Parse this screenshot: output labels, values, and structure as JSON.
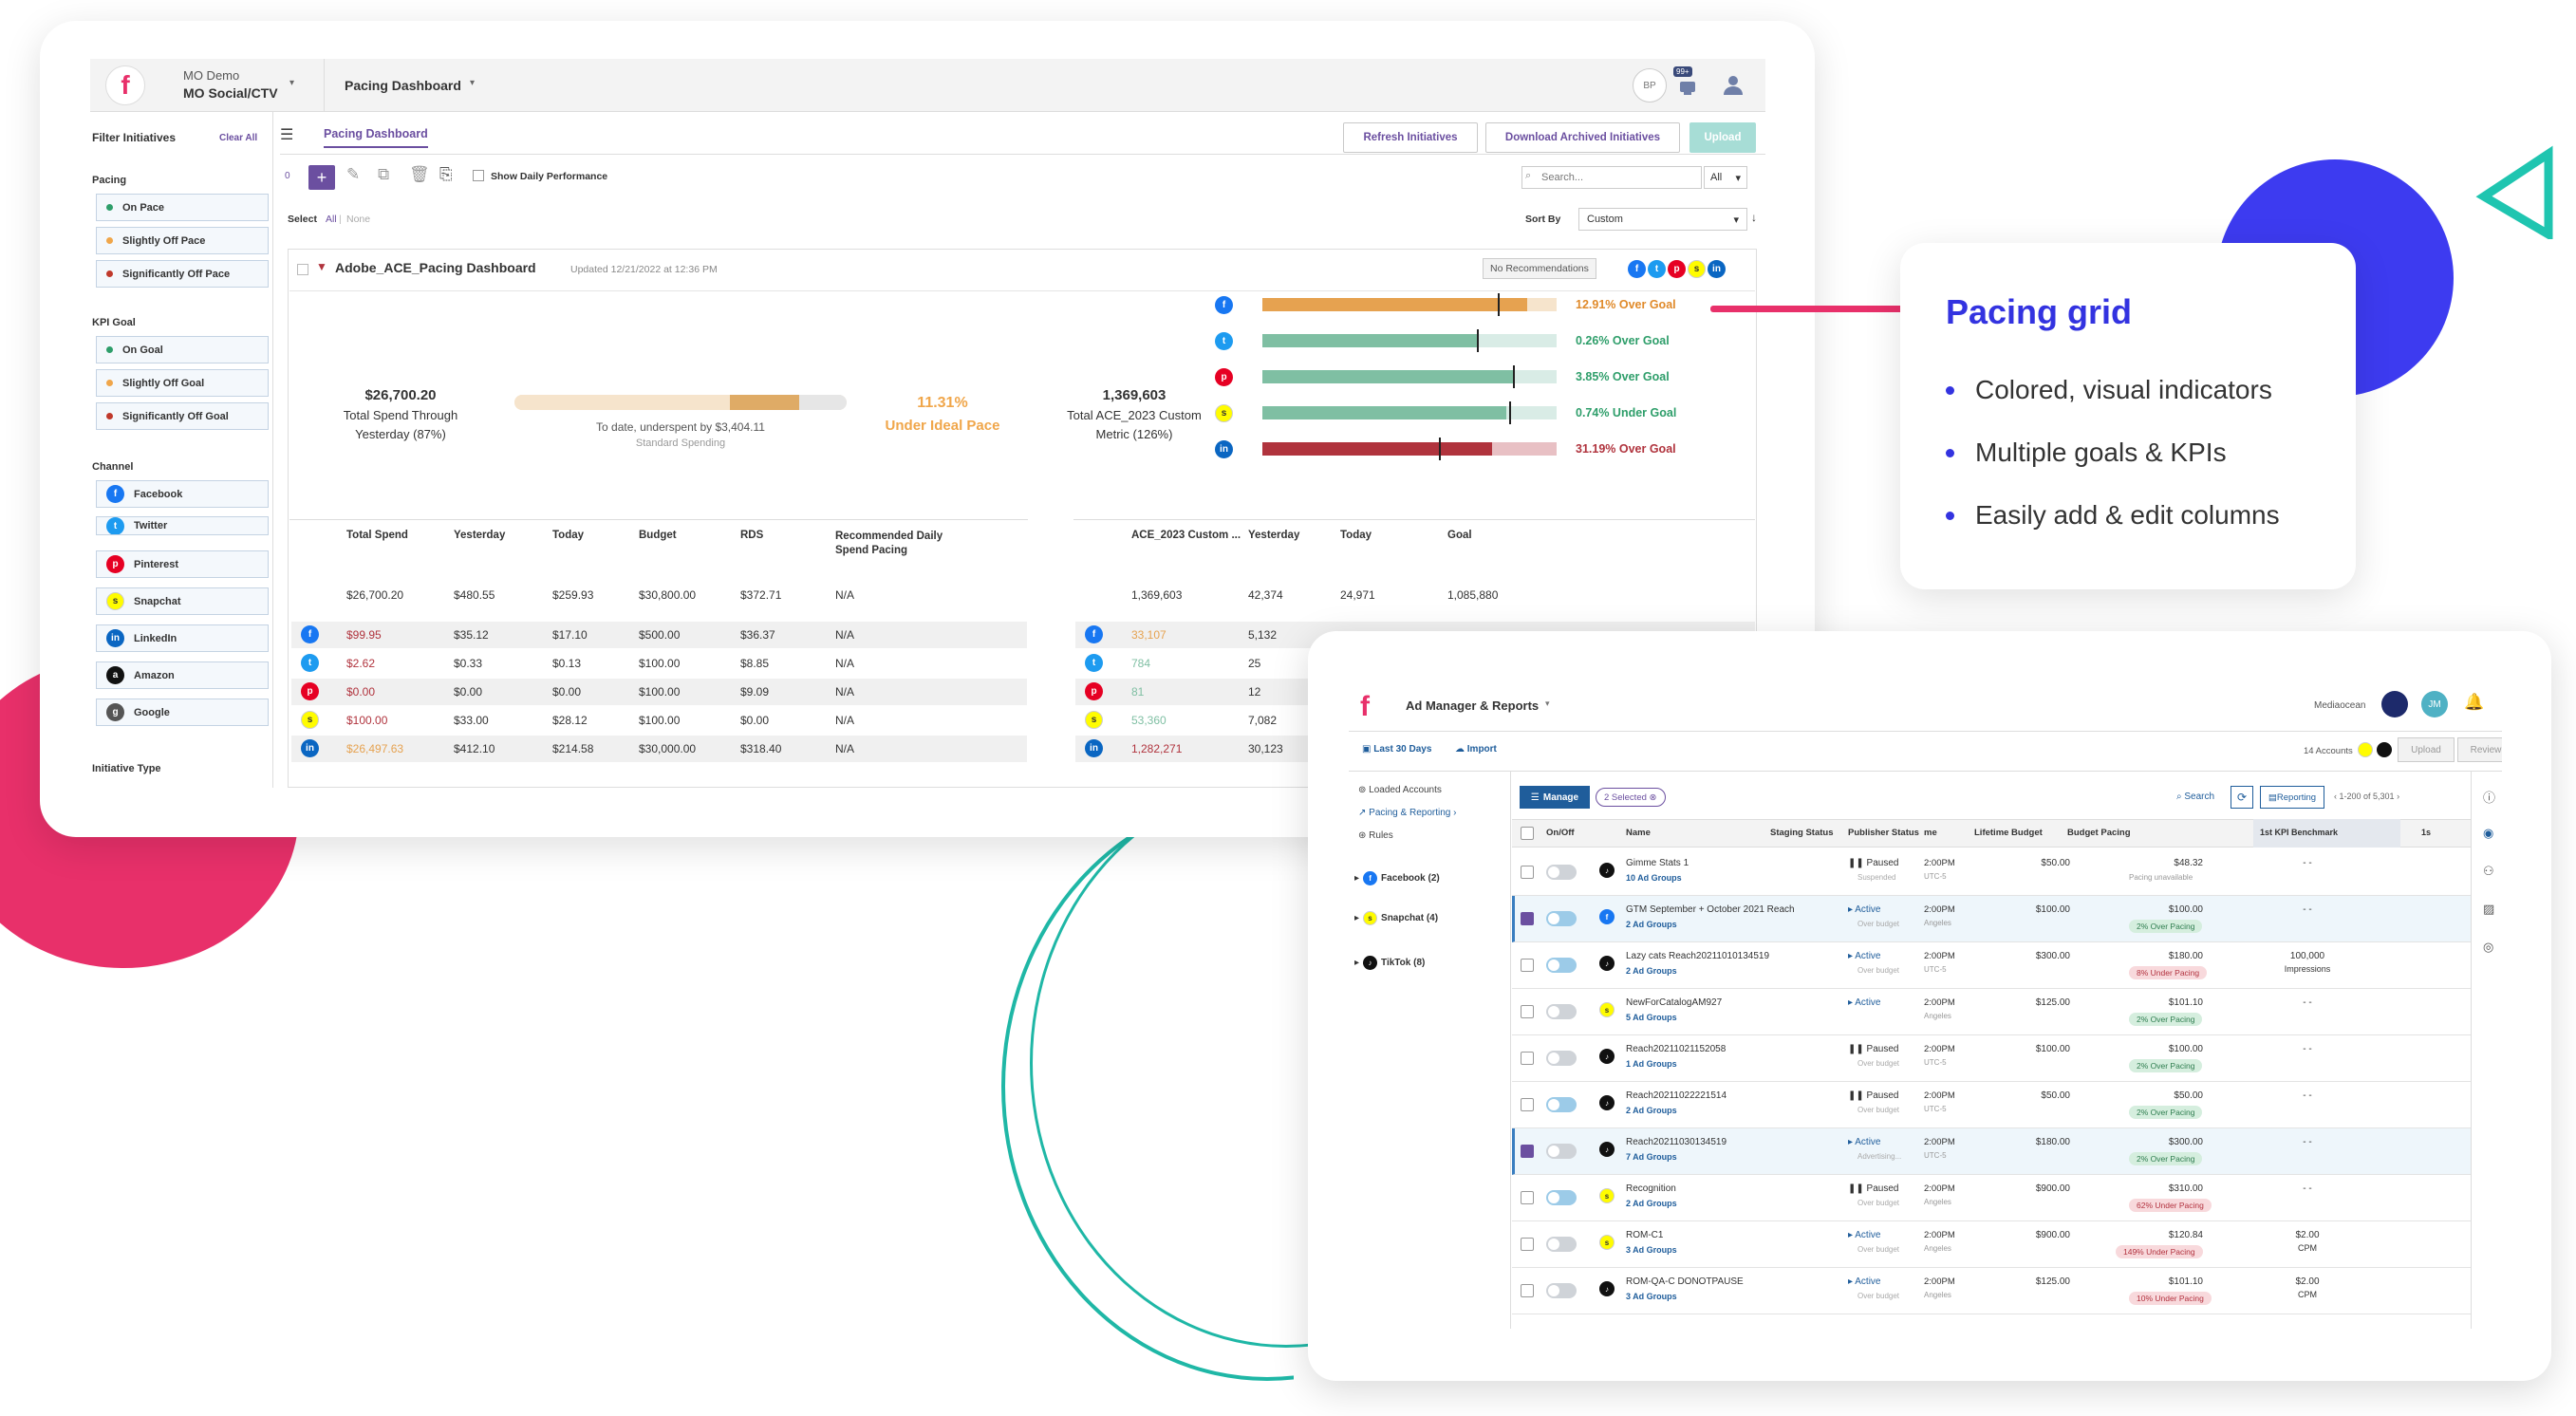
{
  "dashboard": {
    "account_top": "MO Demo",
    "account_name": "MO Social/CTV",
    "view_selector": "Pacing Dashboard",
    "avatar_initials": "BP",
    "notification_badge": "99+",
    "tab": "Pacing Dashboard",
    "buttons": {
      "refresh": "Refresh Initiatives",
      "download": "Download Archived Initiatives",
      "upload": "Upload"
    },
    "toolbar": {
      "count": "0",
      "show_daily": "Show Daily Performance",
      "search_placeholder": "Search...",
      "search_scope": "All"
    },
    "select_row": {
      "label": "Select",
      "all": "All",
      "separator": "|",
      "none": "None"
    },
    "sort": {
      "label": "Sort By",
      "value": "Custom"
    },
    "filters": {
      "title": "Filter Initiatives",
      "clear": "Clear All",
      "pacing_title": "Pacing",
      "pacing": [
        {
          "label": "On Pace",
          "color": "#2e9e6a"
        },
        {
          "label": "Slightly Off Pace",
          "color": "#f0a64a"
        },
        {
          "label": "Significantly Off Pace",
          "color": "#c0392b"
        }
      ],
      "kpi_title": "KPI Goal",
      "kpi": [
        {
          "label": "On Goal",
          "color": "#2e9e6a"
        },
        {
          "label": "Slightly Off Goal",
          "color": "#f0a64a"
        },
        {
          "label": "Significantly Off Goal",
          "color": "#c0392b"
        }
      ],
      "channel_title": "Channel",
      "channels": [
        {
          "label": "Facebook",
          "icon": "facebook-icon"
        },
        {
          "label": "Twitter",
          "icon": "twitter-icon"
        },
        {
          "label": "Pinterest",
          "icon": "pinterest-icon"
        },
        {
          "label": "Snapchat",
          "icon": "snapchat-icon"
        },
        {
          "label": "LinkedIn",
          "icon": "linkedin-icon"
        },
        {
          "label": "Amazon",
          "icon": "amazon-icon"
        },
        {
          "label": "Google",
          "icon": "google-icon"
        }
      ],
      "initiative_type_title": "Initiative Type"
    },
    "initiative": {
      "name": "Adobe_ACE_Pacing Dashboard",
      "updated": "Updated 12/21/2022 at 12:36 PM",
      "recommendations": "No Recommendations",
      "spend_value": "$26,700.20",
      "spend_label_1": "Total Spend Through",
      "spend_label_2": "Yesterday (87%)",
      "spend_progress": 0.87,
      "underspent": "To date, underspent by $3,404.11",
      "standard": "Standard Spending",
      "pace_pct": "11.31%",
      "pace_label": "Under Ideal Pace",
      "metric_value": "1,369,603",
      "metric_label_1": "Total ACE_2023 Custom",
      "metric_label_2": "Metric (126%)",
      "channel_goals": [
        {
          "icon": "facebook-icon",
          "cls": "fb",
          "label": "12.91% Over Goal",
          "color": "#e6a250",
          "fill": 0.9,
          "marker": 0.8,
          "track": "#f6e4cc",
          "lblcolor": "#e08a2a"
        },
        {
          "icon": "twitter-icon",
          "cls": "tw",
          "label": "0.26% Over Goal",
          "color": "#7fbfa3",
          "fill": 0.73,
          "marker": 0.73,
          "track": "#d9ece6",
          "lblcolor": "#2e9e6a"
        },
        {
          "icon": "pinterest-icon",
          "cls": "pi",
          "label": "3.85% Over Goal",
          "color": "#7fbfa3",
          "fill": 0.85,
          "marker": 0.85,
          "track": "#d9ece6",
          "lblcolor": "#2e9e6a"
        },
        {
          "icon": "snapchat-icon",
          "cls": "sc",
          "label": "0.74% Under Goal",
          "color": "#7fbfa3",
          "fill": 0.83,
          "marker": 0.84,
          "track": "#d9ece6",
          "lblcolor": "#2e9e6a"
        },
        {
          "icon": "linkedin-icon",
          "cls": "li",
          "label": "31.19% Over Goal",
          "color": "#b0333d",
          "fill": 0.78,
          "marker": 0.6,
          "track": "#e8c0c4",
          "lblcolor": "#b0333d"
        }
      ]
    },
    "spend_table": {
      "headers": [
        "Total Spend",
        "Yesterday",
        "Today",
        "Budget",
        "RDS",
        "Recommended Daily Spend Pacing"
      ],
      "total": [
        "$26,700.20",
        "$480.55",
        "$259.93",
        "$30,800.00",
        "$372.71",
        "N/A"
      ],
      "rows": [
        {
          "icon": "fb",
          "cells": [
            "$99.95",
            "$35.12",
            "$17.10",
            "$500.00",
            "$36.37",
            "N/A"
          ],
          "color": "#b0333d"
        },
        {
          "icon": "tw",
          "cells": [
            "$2.62",
            "$0.33",
            "$0.13",
            "$100.00",
            "$8.85",
            "N/A"
          ],
          "color": "#b0333d"
        },
        {
          "icon": "pi",
          "cells": [
            "$0.00",
            "$0.00",
            "$0.00",
            "$100.00",
            "$9.09",
            "N/A"
          ],
          "color": "#b0333d"
        },
        {
          "icon": "sc",
          "cells": [
            "$100.00",
            "$33.00",
            "$28.12",
            "$100.00",
            "$0.00",
            "N/A"
          ],
          "color": "#b0333d"
        },
        {
          "icon": "li",
          "cells": [
            "$26,497.63",
            "$412.10",
            "$214.58",
            "$30,000.00",
            "$318.40",
            "N/A"
          ],
          "color": "#e6a250"
        }
      ]
    },
    "metric_table": {
      "headers": [
        "ACE_2023 Custom ...",
        "Yesterday",
        "Today",
        "Goal"
      ],
      "total": [
        "1,369,603",
        "42,374",
        "24,971",
        "1,085,880"
      ],
      "rows": [
        {
          "icon": "fb",
          "cells": [
            "33,107",
            "5,132"
          ],
          "color": "#e6a250"
        },
        {
          "icon": "tw",
          "cells": [
            "784",
            "25"
          ],
          "color": "#7fbfa3"
        },
        {
          "icon": "pi",
          "cells": [
            "81",
            "12"
          ],
          "color": "#7fbfa3"
        },
        {
          "icon": "sc",
          "cells": [
            "53,360",
            "7,082"
          ],
          "color": "#7fbfa3"
        },
        {
          "icon": "li",
          "cells": [
            "1,282,271",
            "30,123"
          ],
          "color": "#b0333d"
        }
      ]
    }
  },
  "callout": {
    "title": "Pacing grid",
    "items": [
      "Colored, visual indicators",
      "Multiple goals & KPIs",
      "Easily add & edit columns"
    ]
  },
  "admanager": {
    "title": "Ad Manager & Reports",
    "org": "Mediaocean",
    "avatar": "JM",
    "date_range": "Last 30 Days",
    "import": "Import",
    "accounts": "14 Accounts",
    "upload": "Upload",
    "review": "Review",
    "nav": [
      "Loaded Accounts",
      "Pacing & Reporting",
      "Rules"
    ],
    "nav_groups": [
      {
        "label": "Facebook (2)",
        "icon": "fb"
      },
      {
        "label": "Snapchat (4)",
        "icon": "sc"
      },
      {
        "label": "TikTok (8)",
        "icon": "tt"
      }
    ],
    "manage": "Manage",
    "selected": "2 Selected",
    "search": "Search",
    "reporting": "Reporting",
    "pagination": "1-200 of 5,301",
    "columns": [
      "On/Off",
      "Name",
      "Staging Status",
      "Publisher Status",
      "me",
      "Lifetime Budget",
      "Budget Pacing",
      "1st KPI Benchmark",
      "1s"
    ],
    "rows": [
      {
        "sel": false,
        "on": false,
        "icon": "tt",
        "name": "Gimme Stats 1",
        "groups": "10 Ad Groups",
        "status": "Paused",
        "sub": "Suspended",
        "time": "2:00PM",
        "tz": "UTC-5",
        "budget": "$50.00",
        "pace": "$48.32",
        "pill": "Pacing unavailable",
        "pillcls": "",
        "kpi": "- -",
        "kpi2": ""
      },
      {
        "sel": true,
        "on": true,
        "icon": "fb",
        "name": "GTM September + October 2021 Reach",
        "groups": "2 Ad Groups",
        "status": "Active",
        "sub": "Over budget",
        "time": "2:00PM",
        "tz": "Angeles",
        "budget": "$100.00",
        "pace": "$100.00",
        "pill": "2% Over Pacing",
        "pillcls": "over",
        "kpi": "- -",
        "kpi2": ""
      },
      {
        "sel": false,
        "on": true,
        "icon": "tt",
        "name": "Lazy cats Reach20211010134519",
        "groups": "2 Ad Groups",
        "status": "Active",
        "sub": "Over budget",
        "time": "2:00PM",
        "tz": "UTC-5",
        "budget": "$300.00",
        "pace": "$180.00",
        "pill": "8% Under Pacing",
        "pillcls": "under",
        "kpi": "100,000",
        "kpi2": "Impressions"
      },
      {
        "sel": false,
        "on": false,
        "icon": "sc",
        "name": "NewForCatalogAM927",
        "groups": "5 Ad Groups",
        "status": "Active",
        "sub": "",
        "time": "2:00PM",
        "tz": "Angeles",
        "budget": "$125.00",
        "pace": "$101.10",
        "pill": "2% Over Pacing",
        "pillcls": "over",
        "kpi": "- -",
        "kpi2": ""
      },
      {
        "sel": false,
        "on": false,
        "icon": "tt",
        "name": "Reach20211021152058",
        "groups": "1 Ad Groups",
        "status": "Paused",
        "sub": "Over budget",
        "time": "2:00PM",
        "tz": "UTC-5",
        "budget": "$100.00",
        "pace": "$100.00",
        "pill": "2% Over Pacing",
        "pillcls": "over",
        "kpi": "- -",
        "kpi2": ""
      },
      {
        "sel": false,
        "on": true,
        "icon": "tt",
        "name": "Reach20211022221514",
        "groups": "2 Ad Groups",
        "status": "Paused",
        "sub": "Over budget",
        "time": "2:00PM",
        "tz": "UTC-5",
        "budget": "$50.00",
        "pace": "$50.00",
        "pill": "2% Over Pacing",
        "pillcls": "over",
        "kpi": "- -",
        "kpi2": ""
      },
      {
        "sel": true,
        "on": false,
        "icon": "tt",
        "name": "Reach20211030134519",
        "groups": "7 Ad Groups",
        "status": "Active",
        "sub": "Advertising...",
        "time": "2:00PM",
        "tz": "UTC-5",
        "budget": "$180.00",
        "pace": "$300.00",
        "pill": "2% Over Pacing",
        "pillcls": "over",
        "kpi": "- -",
        "kpi2": ""
      },
      {
        "sel": false,
        "on": true,
        "icon": "sc",
        "name": "Recognition",
        "groups": "2 Ad Groups",
        "status": "Paused",
        "sub": "Over budget",
        "time": "2:00PM",
        "tz": "Angeles",
        "budget": "$900.00",
        "pace": "$310.00",
        "pill": "62% Under Pacing",
        "pillcls": "under",
        "kpi": "- -",
        "kpi2": ""
      },
      {
        "sel": false,
        "on": false,
        "icon": "sc",
        "name": "ROM-C1",
        "groups": "3 Ad Groups",
        "status": "Active",
        "sub": "Over budget",
        "time": "2:00PM",
        "tz": "Angeles",
        "budget": "$900.00",
        "pace": "$120.84",
        "pill": "149% Under Pacing",
        "pillcls": "under",
        "kpi": "$2.00",
        "kpi2": "CPM"
      },
      {
        "sel": false,
        "on": false,
        "icon": "tt",
        "name": "ROM-QA-C DONOTPAUSE",
        "groups": "3 Ad Groups",
        "status": "Active",
        "sub": "Over budget",
        "time": "2:00PM",
        "tz": "Angeles",
        "budget": "$125.00",
        "pace": "$101.10",
        "pill": "10% Under Pacing",
        "pillcls": "under",
        "kpi": "$2.00",
        "kpi2": "CPM"
      }
    ]
  }
}
